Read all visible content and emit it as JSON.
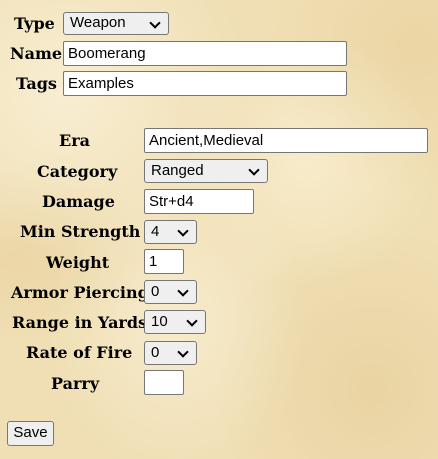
{
  "header": {
    "type": {
      "label": "Type",
      "value": "Weapon"
    },
    "name": {
      "label": "Name",
      "value": "Boomerang"
    },
    "tags": {
      "label": "Tags",
      "value": "Examples"
    }
  },
  "fields": {
    "era": {
      "label": "Era",
      "value": "Ancient,Medieval"
    },
    "category": {
      "label": "Category",
      "value": "Ranged"
    },
    "damage": {
      "label": "Damage",
      "value": "Str+d4"
    },
    "min_strength": {
      "label": "Min Strength",
      "value": "4"
    },
    "weight": {
      "label": "Weight",
      "value": "1"
    },
    "armor_piercing": {
      "label": "Armor Piercing",
      "value": "0"
    },
    "range": {
      "label": "Range in Yards",
      "value": "10"
    },
    "rate_of_fire": {
      "label": "Rate of Fire",
      "value": "0"
    },
    "parry": {
      "label": "Parry",
      "value": ""
    }
  },
  "actions": {
    "save_label": "Save"
  }
}
